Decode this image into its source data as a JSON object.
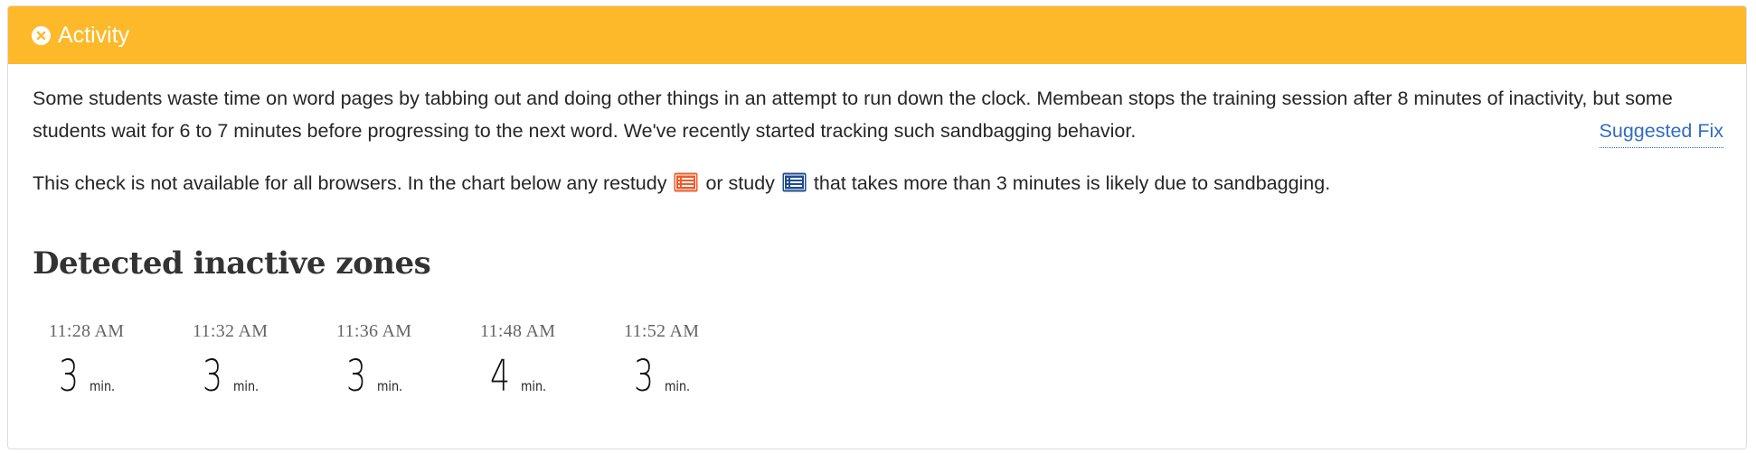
{
  "header": {
    "title": "Activity",
    "color": "#fdb92a",
    "close_icon": "circle-x-icon"
  },
  "intro": {
    "text": "Some students waste time on word pages by tabbing out and doing other things in an attempt to run down the clock. Membean stops the training session after 8 minutes of inactivity, but some students wait for 6 to 7 minutes before progressing to the next word. We've recently started tracking such sandbagging behavior.",
    "suggested_fix_label": "Suggested Fix"
  },
  "note": {
    "part1": "This check is not available for all browsers. In the chart below any restudy",
    "restudy_icon": "restudy-list-icon",
    "restudy_color": "#f05a28",
    "part2": "or study",
    "study_icon": "study-list-icon",
    "study_color": "#1f4b8f",
    "part3": "that takes more than 3 minutes is likely due to sandbagging."
  },
  "section": {
    "title": "Detected inactive zones"
  },
  "zones": [
    {
      "time": "11:28 AM",
      "minutes": "3",
      "unit": "min."
    },
    {
      "time": "11:32 AM",
      "minutes": "3",
      "unit": "min."
    },
    {
      "time": "11:36 AM",
      "minutes": "3",
      "unit": "min."
    },
    {
      "time": "11:48 AM",
      "minutes": "4",
      "unit": "min."
    },
    {
      "time": "11:52 AM",
      "minutes": "3",
      "unit": "min."
    }
  ]
}
